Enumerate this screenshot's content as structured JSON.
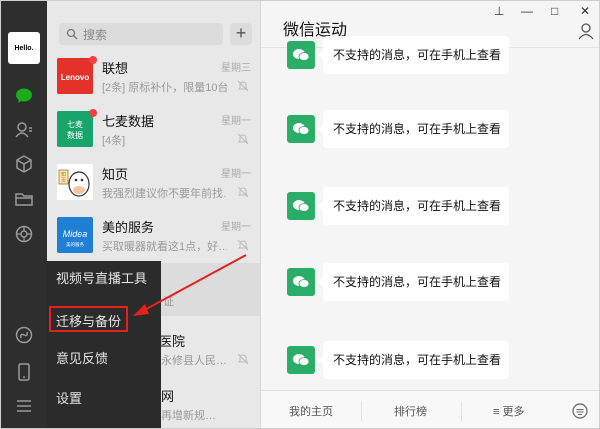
{
  "sidebar": {
    "avatar_text": "Hello."
  },
  "search": {
    "placeholder": "搜索",
    "add_label": "+"
  },
  "conversations": [
    {
      "name": "联想",
      "message": "[2条] 原标补仆，限量10台…",
      "time": "星期三"
    },
    {
      "name": "七麦数据",
      "message": "[4条]",
      "time": "星期一"
    },
    {
      "name": "知页",
      "message": "我强烈建议你不要年前找…",
      "time": "星期一"
    },
    {
      "name": "美的服务",
      "message": "买取暖器就看这1点，好…",
      "time": "星期一"
    },
    {
      "name": "医院",
      "message": "永修县人民…",
      "time": ""
    },
    {
      "name": "网",
      "message": "再增新规…",
      "time": ""
    }
  ],
  "menu": {
    "items": [
      "视频号直播工具",
      "迁移与备份",
      "意见反馈",
      "设置"
    ],
    "partial_text": "证"
  },
  "chat": {
    "title": "微信运动",
    "messages": [
      "不支持的消息，可在手机上查看",
      "不支持的消息，可在手机上查看",
      "不支持的消息，可在手机上查看",
      "不支持的消息，可在手机上查看",
      "不支持的消息，可在手机上查看"
    ],
    "bottom": {
      "home": "我的主页",
      "rank": "排行榜",
      "more": "≡ 更多"
    }
  },
  "window": {
    "pin": "⊥",
    "min": "—",
    "max": "□",
    "close": "✕"
  },
  "colors": {
    "accent_green": "#2aae67",
    "highlight_red": "#e8201d",
    "sidebar_bg": "#2e2e2e"
  }
}
